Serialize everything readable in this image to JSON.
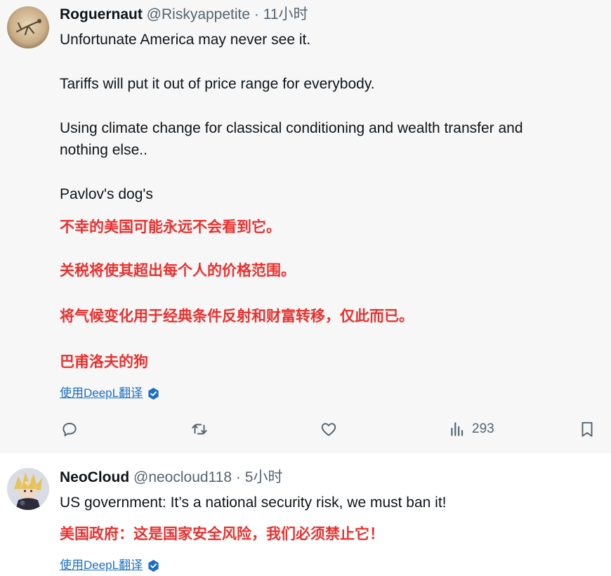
{
  "tweets": [
    {
      "name": "Roguernaut",
      "handle": "@Riskyappetite",
      "sep": "·",
      "time": "11小时",
      "lines": [
        "Unfortunate America may never see it.",
        "Tariffs will put it out of price range for everybody.",
        "Using climate change for classical conditioning and wealth transfer and",
        "nothing else..",
        "Pavlov's dog's"
      ],
      "translation": [
        "不幸的美国可能永远不会看到它。",
        "关税将使其超出每个人的价格范围。",
        "将气候变化用于经典条件反射和财富转移，仅此而已。",
        "巴甫洛夫的狗"
      ],
      "deepl_label": "使用DeepL翻译",
      "views": "293",
      "icons": [
        "reply-icon",
        "retweet-icon",
        "like-icon",
        "views-icon",
        "bookmark-icon"
      ]
    },
    {
      "name": "NeoCloud",
      "handle": "@neocloud118",
      "sep": "·",
      "time": "5小时",
      "lines": [
        "US government: It’s a national security risk, we must ban it!"
      ],
      "translation": [
        "美国政府：这是国家安全风险，我们必须禁止它！"
      ],
      "deepl_label": "使用DeepL翻译"
    }
  ],
  "colors": {
    "translation": "#e8312f",
    "link": "#1d6fc0",
    "muted": "#536471",
    "highlight_bg": "#f7f7f7"
  }
}
